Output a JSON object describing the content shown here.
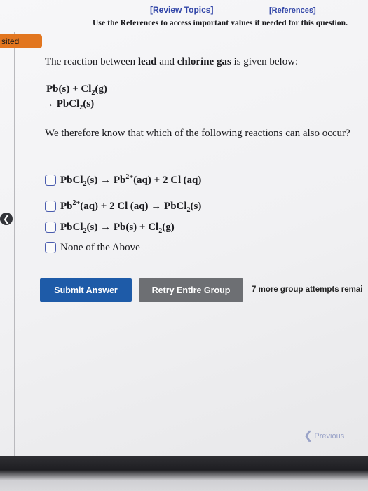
{
  "header": {
    "review_topics": "[Review Topics]",
    "references": "[References]",
    "instruction": "Use the References to access important values if needed for this question."
  },
  "sidebar": {
    "visited_tab": "sited",
    "back_icon": "chevron-left-icon"
  },
  "question": {
    "intro_plain1": "The reaction between ",
    "intro_bold1": "lead",
    "intro_plain2": " and ",
    "intro_bold2": "chlorine gas",
    "intro_plain3": " is given below:",
    "eq_line1": {
      "a": "Pb(s) + Cl",
      "a_sub": "2",
      "b": "(g)"
    },
    "eq_line2": {
      "a": "→ PbCl",
      "a_sub": "2",
      "b": "(s)"
    },
    "prompt": "We therefore know that which of the following reactions can also occur?"
  },
  "options": [
    {
      "a": "PbCl",
      "a_sub": "2",
      "b": "(s) → Pb",
      "b_sup": "2+",
      "c": "(aq) + 2 Cl",
      "c_sup": "-",
      "d": "(aq)"
    },
    {
      "a": "Pb",
      "a_sup": "2+",
      "b": "(aq) + 2 Cl",
      "b_sup": "-",
      "c": "(aq) → PbCl",
      "c_sub": "2",
      "d": "(s)"
    },
    {
      "a": "PbCl",
      "a_sub": "2",
      "b": "(s) → Pb(s) + Cl",
      "b_sub": "2",
      "c": "(g)"
    },
    {
      "label": "None of the Above"
    }
  ],
  "actions": {
    "submit": "Submit Answer",
    "retry": "Retry Entire Group",
    "attempts": "7 more group attempts remai"
  },
  "footer": {
    "previous": "Previous"
  },
  "colors": {
    "submit_bg": "#1e5ba8",
    "retry_bg": "#6d6f73",
    "visited_tab": "#e2761f",
    "link": "#3246a8"
  }
}
